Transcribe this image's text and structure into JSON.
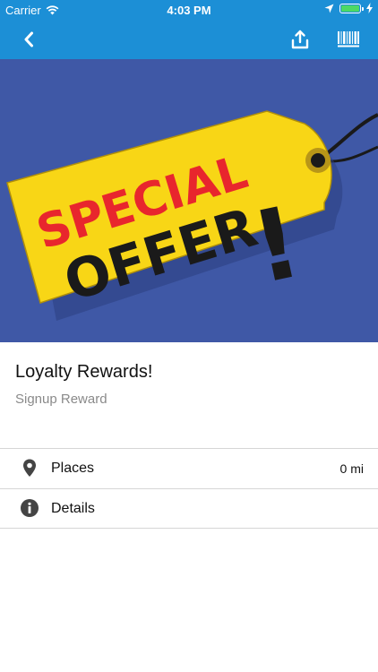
{
  "status_bar": {
    "carrier": "Carrier",
    "time": "4:03 PM"
  },
  "nav": {
    "back_icon": "chevron-left-icon",
    "share_icon": "share-icon",
    "barcode_icon": "barcode-icon"
  },
  "hero": {
    "line1": "SPECIAL",
    "line2": "OFFER",
    "exclaim": "!"
  },
  "offer": {
    "title": "Loyalty Rewards!",
    "subtitle": "Signup Reward"
  },
  "rows": [
    {
      "label": "Places",
      "value": "0 mi",
      "icon": "location-pin-icon"
    },
    {
      "label": "Details",
      "icon": "info-icon"
    }
  ],
  "colors": {
    "header": "#1c8fd6",
    "hero_bg": "#3f58a6",
    "tag_yellow": "#f8d616",
    "special_red": "#e8262d"
  }
}
